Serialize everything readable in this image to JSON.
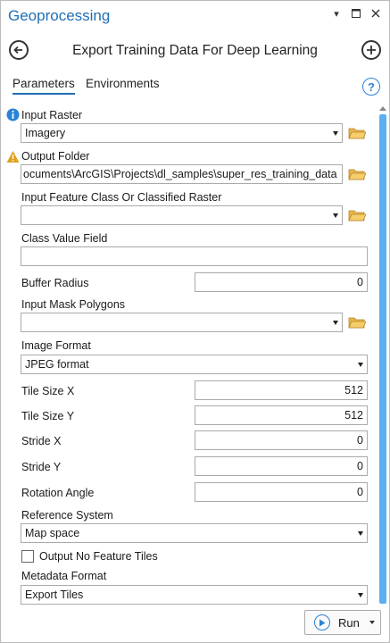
{
  "pane": {
    "title": "Geoprocessing",
    "tool_title": "Export Training Data For Deep Learning"
  },
  "tabs": [
    {
      "label": "Parameters",
      "active": true
    },
    {
      "label": "Environments",
      "active": false
    }
  ],
  "params": {
    "input_raster": {
      "label": "Input Raster",
      "value": "Imagery",
      "status": "info-icon"
    },
    "output_folder": {
      "label": "Output Folder",
      "value": "ocuments\\ArcGIS\\Projects\\dl_samples\\super_res_training_data",
      "status": "warning-icon"
    },
    "input_feature": {
      "label": "Input Feature Class Or Classified Raster",
      "value": ""
    },
    "class_value_field": {
      "label": "Class Value Field",
      "value": ""
    },
    "buffer_radius": {
      "label": "Buffer Radius",
      "value": "0"
    },
    "input_mask": {
      "label": "Input Mask Polygons",
      "value": ""
    },
    "image_format": {
      "label": "Image Format",
      "value": "JPEG format"
    },
    "tile_size_x": {
      "label": "Tile Size X",
      "value": "512"
    },
    "tile_size_y": {
      "label": "Tile Size Y",
      "value": "512"
    },
    "stride_x": {
      "label": "Stride X",
      "value": "0"
    },
    "stride_y": {
      "label": "Stride Y",
      "value": "0"
    },
    "rotation_angle": {
      "label": "Rotation Angle",
      "value": "0"
    },
    "reference_system": {
      "label": "Reference System",
      "value": "Map space"
    },
    "output_no_feature_tiles": {
      "label": "Output No Feature Tiles",
      "checked": false
    },
    "metadata_format": {
      "label": "Metadata Format",
      "value": "Export Tiles"
    }
  },
  "footer": {
    "run_label": "Run"
  },
  "colors": {
    "accent": "#1f6fb4",
    "scroll": "#5aaff3",
    "folder": "#e8b64a",
    "warning": "#e0a21b",
    "info": "#2b83d6"
  }
}
